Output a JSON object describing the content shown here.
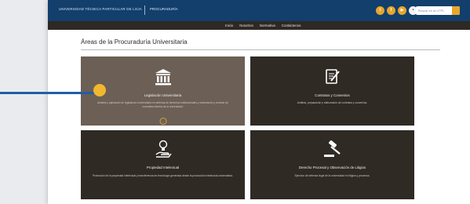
{
  "header": {
    "brand": "UNIVERSIDAD TÉCNICA PARTICULAR DE LOJA",
    "unit": "PROCURADURÍA",
    "circle_icons": [
      {
        "name": "twitter-icon",
        "glyph": "t"
      },
      {
        "name": "facebook-icon",
        "glyph": "f"
      },
      {
        "name": "youtube-icon",
        "glyph": "▶"
      },
      {
        "name": "user-icon",
        "glyph": "•"
      }
    ],
    "search_placeholder": "Buscar en la UTPL",
    "accent": "#e8a62d",
    "background": "#123f6c"
  },
  "nav": {
    "items": [
      "Inicio",
      "Nosotros",
      "Normativa",
      "Contáctenos"
    ]
  },
  "main": {
    "title": "Áreas de la Procuraduría Universitaria",
    "cards": [
      {
        "title": "Legislación Universitaria",
        "description": "Análisis y aplicación de legislación universitaria en defensa de derechos institucionales y elaboración y revisión de normativa interna de la universidad.",
        "icon": "building-columns-icon",
        "active": true,
        "chevron": "⌄"
      },
      {
        "title": "Contratos y Convenios",
        "description": "Análisis, preparación y elaboración de contratos y convenios.",
        "icon": "document-edit-icon",
        "active": false
      },
      {
        "title": "Propiedad Intelectual",
        "description": "Protección de la propiedad intelectual y transferencia de tecnología generada desde la producción intelectual universitaria.",
        "icon": "lightbulb-hand-icon",
        "active": false
      },
      {
        "title": "Derecho Procesal y Observación de Litigios",
        "description": "Ejercicio de defensa legal de la universidad en litigios y procesos.",
        "icon": "gavel-icon",
        "active": false
      }
    ]
  },
  "annotation": {
    "pointer_color": "#1f5fa4",
    "dot_color": "#f1b72f"
  }
}
